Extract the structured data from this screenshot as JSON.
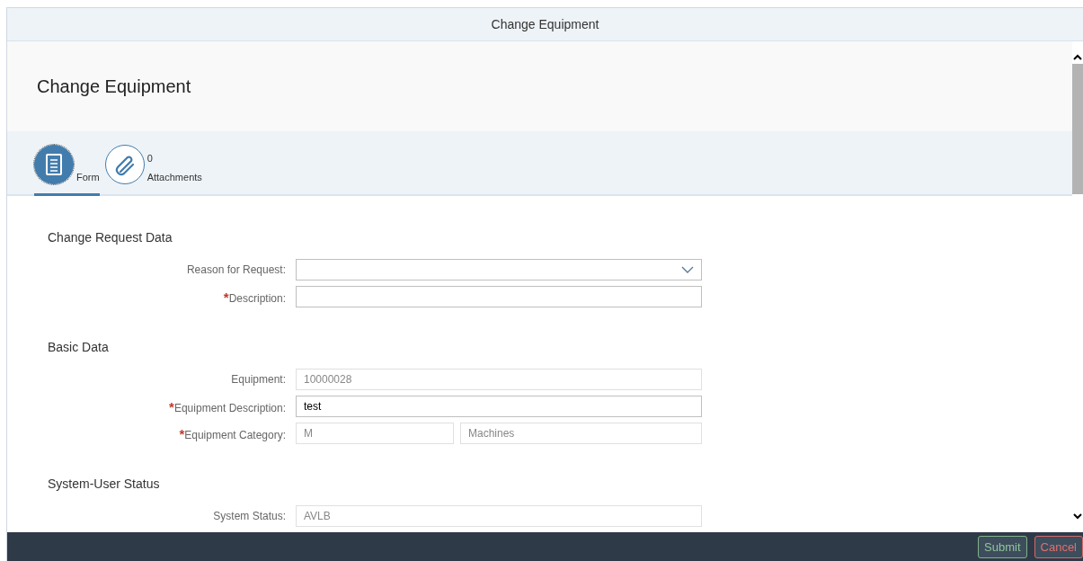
{
  "window": {
    "title": "Change Equipment"
  },
  "header": {
    "title": "Change Equipment"
  },
  "required_mark": "*",
  "tabs": [
    {
      "kind": "form",
      "label": "Form",
      "selected": true
    },
    {
      "kind": "attachments",
      "label": "Attachments",
      "count": "0",
      "selected": false
    }
  ],
  "sections": [
    {
      "title": "Change Request Data",
      "fields": [
        {
          "kind": "dropdown",
          "label": "Reason for Request:",
          "required": false,
          "readonly": false
        },
        {
          "kind": "text",
          "label": "Description:",
          "required": true,
          "readonly": false
        }
      ]
    },
    {
      "title": "Basic Data",
      "fields": [
        {
          "kind": "text",
          "label": "Equipment:",
          "required": false,
          "readonly": true,
          "value": "10000028"
        },
        {
          "kind": "text",
          "label": "Equipment Description:",
          "required": true,
          "readonly": false,
          "value": "test"
        },
        {
          "kind": "pair",
          "label": "Equipment Category:",
          "required": true,
          "readonly": true,
          "value": "M",
          "value_2": "Machines"
        }
      ]
    },
    {
      "title": "System-User Status",
      "fields": [
        {
          "kind": "text",
          "label": "System Status:",
          "required": false,
          "readonly": true,
          "value": "AVLB"
        }
      ]
    }
  ],
  "footer": {
    "buttons": [
      {
        "kind": "submit",
        "label": "Submit"
      },
      {
        "kind": "cancel",
        "label": "Cancel"
      }
    ]
  }
}
